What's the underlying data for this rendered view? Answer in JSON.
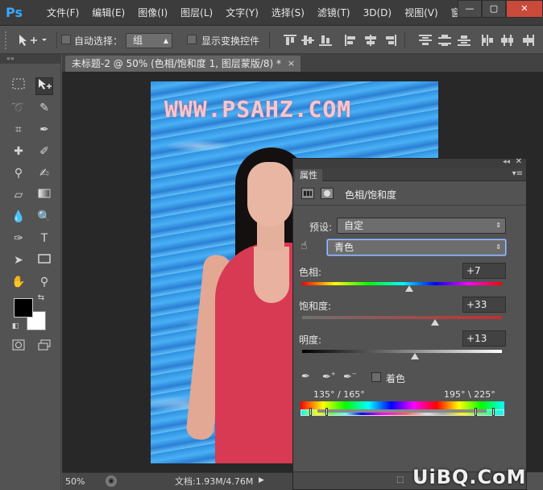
{
  "menubar": {
    "logo": "Ps",
    "items": [
      "文件(F)",
      "编辑(E)",
      "图像(I)",
      "图层(L)",
      "文字(Y)",
      "选择(S)",
      "滤镜(T)",
      "3D(D)",
      "视图(V)",
      "窗口"
    ],
    "window_controls": {
      "minimize": "—",
      "restore": "▢",
      "close": "✕"
    }
  },
  "options": {
    "tool_icon": "move-tool-icon",
    "auto_select_label": "自动选择：",
    "auto_select_value": "组",
    "show_transform_label": "显示变换控件"
  },
  "document": {
    "tab_title": "未标题-2 @ 50% (色相/饱和度 1, 图层蒙版/8) *",
    "tab_close": "×",
    "image_watermark": "WWW.PSAHZ.COM"
  },
  "statusbar": {
    "zoom": "50%",
    "doc_info": "文档:1.93M/4.76M"
  },
  "properties": {
    "tab": "属性",
    "adjustment_title": "色相/饱和度",
    "preset_label": "预设:",
    "preset_value": "自定",
    "channel_value": "青色",
    "hue": {
      "label": "色相:",
      "value": "+7",
      "position": 0.535
    },
    "saturation": {
      "label": "饱和度:",
      "value": "+33",
      "position": 0.665
    },
    "lightness": {
      "label": "明度:",
      "value": "+13",
      "position": 0.565
    },
    "colorize_label": "着色",
    "range_left": "135° / 165°",
    "range_right": "195° \\ 225°"
  },
  "watermark_site": "UiBQ.CoM",
  "colors": {
    "foreground": "#000000",
    "background": "#ffffff",
    "ps_blue": "#39a9ff"
  }
}
